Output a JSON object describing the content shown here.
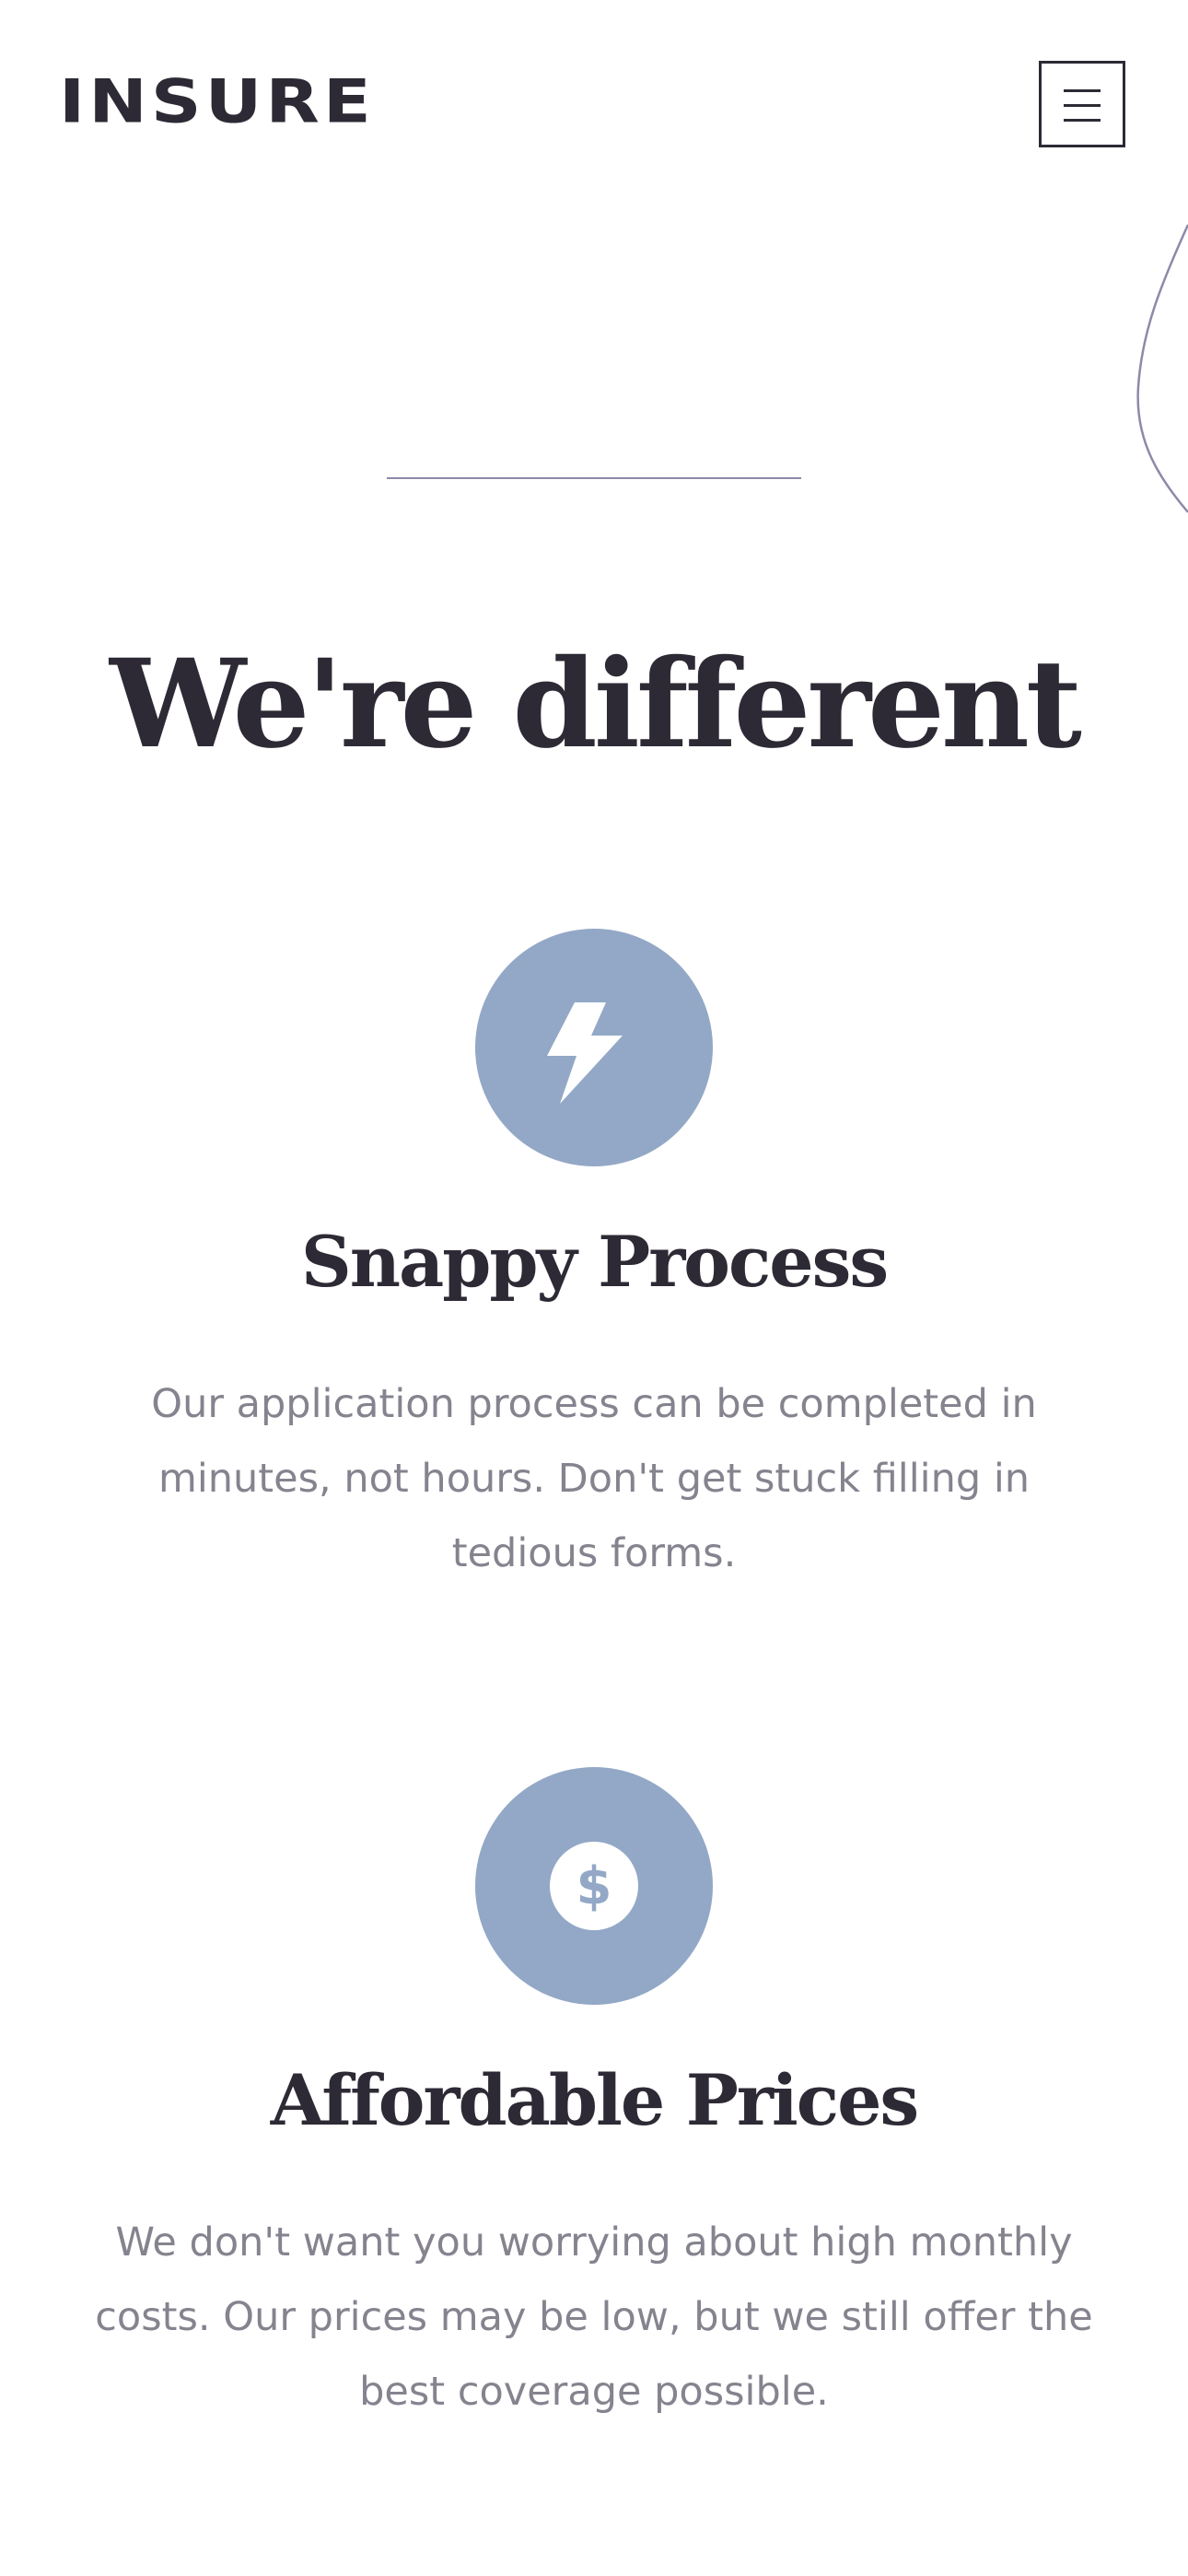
{
  "header": {
    "logo_text": "INSURE",
    "menu_icon": "hamburger-menu-icon"
  },
  "decor": {
    "divider_color": "#8c8aa8",
    "curve_color": "#8c8aa8"
  },
  "section": {
    "title": "We're different"
  },
  "features": [
    {
      "icon": "lightning-bolt-icon",
      "title": "Snappy Process",
      "lines": [
        "Our application process can be completed in",
        "minutes, not hours. Don't get stuck filling in",
        "tedious forms."
      ]
    },
    {
      "icon": "dollar-coin-icon",
      "title": "Affordable Prices",
      "lines": [
        "We don't want you worrying about high monthly",
        "costs. Our prices may be low, but we still offer the",
        "best coverage possible."
      ]
    }
  ],
  "colors": {
    "text_dark": "#2d2a35",
    "text_muted": "#86838f",
    "icon_circle": "#93a8c6",
    "background": "#ffffff"
  }
}
